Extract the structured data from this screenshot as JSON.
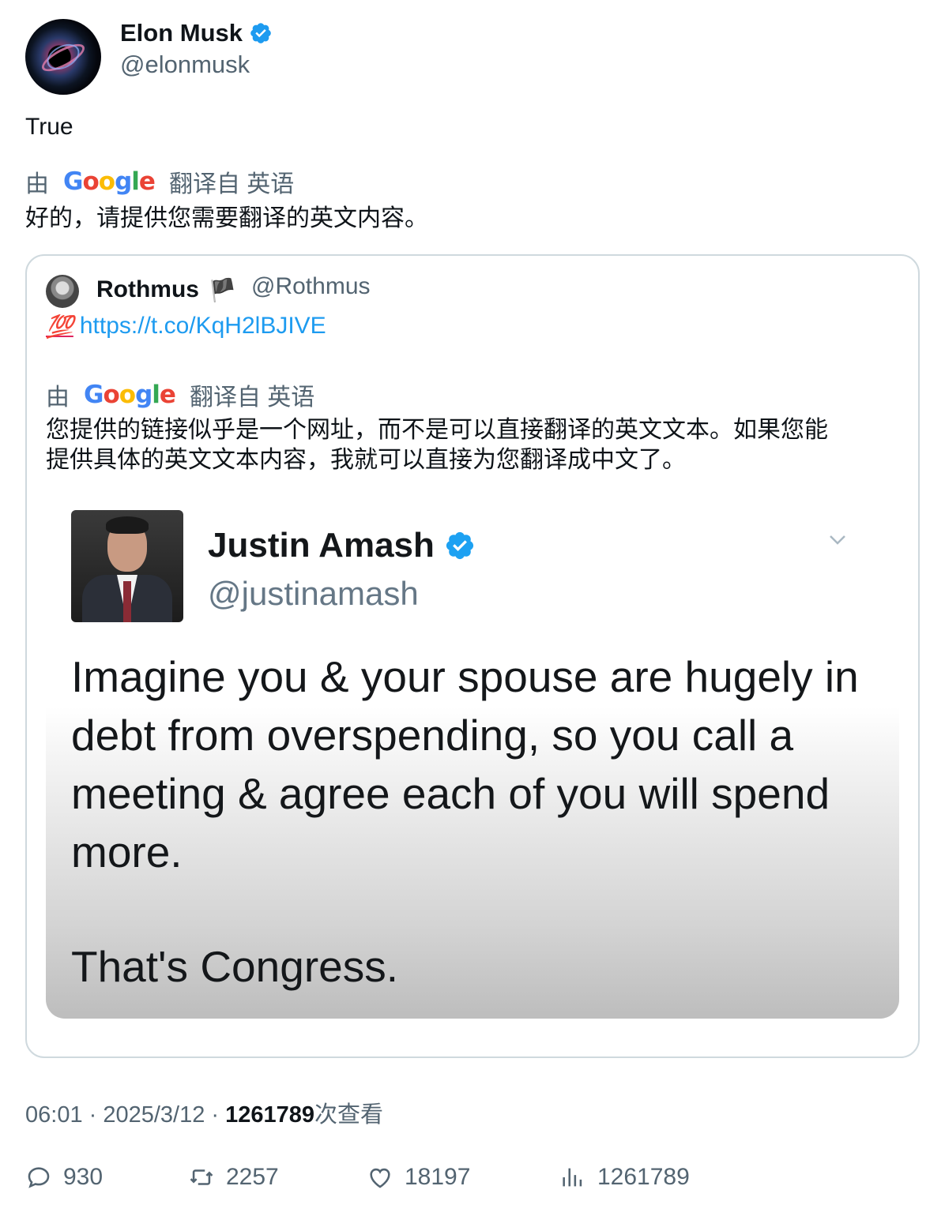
{
  "author": {
    "name": "Elon Musk",
    "handle": "@elonmusk",
    "verified": true
  },
  "tweet": {
    "text": "True",
    "translate_by": "由",
    "translate_from": "翻译自 英语",
    "translation": "好的，请提供您需要翻译的英文内容。"
  },
  "google_logo": [
    "G",
    "o",
    "o",
    "g",
    "l",
    "e"
  ],
  "quote": {
    "name": "Rothmus",
    "flag": "🏴",
    "handle": "@Rothmus",
    "emoji": "💯",
    "link": "https://t.co/KqH2lBJIVE",
    "translate_by": "由",
    "translate_from": "翻译自 英语",
    "translation_line1": "您提供的链接似乎是一个网址，而不是可以直接翻译的英文文本。如果您能",
    "translation_line2": "提供具体的英文文本内容，我就可以直接为您翻译成中文了。"
  },
  "embedded_image": {
    "name": "Justin Amash",
    "handle": "@justinamash",
    "verified": true,
    "text": "Imagine you & your spouse are hugely in debt from overspending, so you call a meeting & agree each of you will spend more.",
    "text2": "That's Congress."
  },
  "meta": {
    "time": "06:01 · 2025/3/12 · ",
    "views": "1261789",
    "views_suffix": "次查看"
  },
  "actions": {
    "replies": "930",
    "retweets": "2257",
    "likes": "18197",
    "views": "1261789"
  },
  "colors": {
    "accent": "#1d9bf0",
    "muted": "#536471",
    "text": "#0f1419",
    "border": "#cfd9de"
  }
}
